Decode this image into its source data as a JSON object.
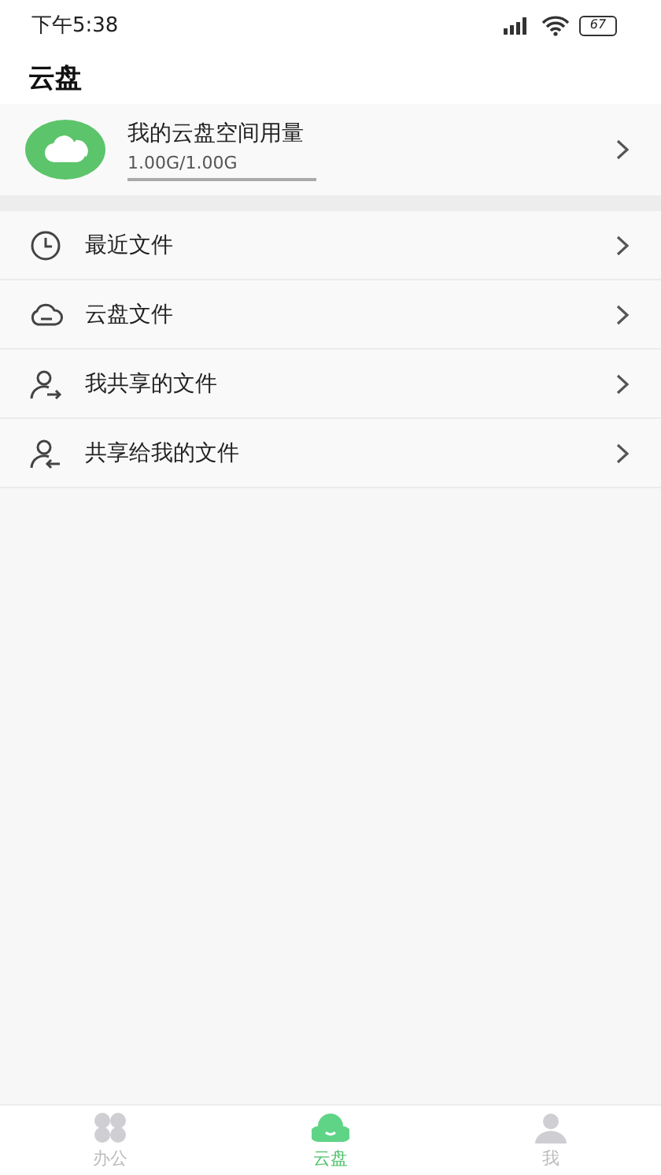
{
  "status_bar": {
    "time": "下午5:38",
    "battery": "67"
  },
  "header": {
    "title": "云盘"
  },
  "storage": {
    "title": "我的云盘空间用量",
    "usage": "1.00G/1.00G",
    "level": 1
  },
  "menu": [
    {
      "kind": "clock",
      "label": "最近文件"
    },
    {
      "kind": "cloud",
      "label": "云盘文件"
    },
    {
      "kind": "share-out",
      "label": "我共享的文件"
    },
    {
      "kind": "share-in",
      "label": "共享给我的文件"
    }
  ],
  "tabs": [
    {
      "kind": "office",
      "label": "办公",
      "selected": false
    },
    {
      "kind": "cloud",
      "label": "云盘",
      "selected": true
    },
    {
      "kind": "me",
      "label": "我",
      "selected": false
    }
  ]
}
